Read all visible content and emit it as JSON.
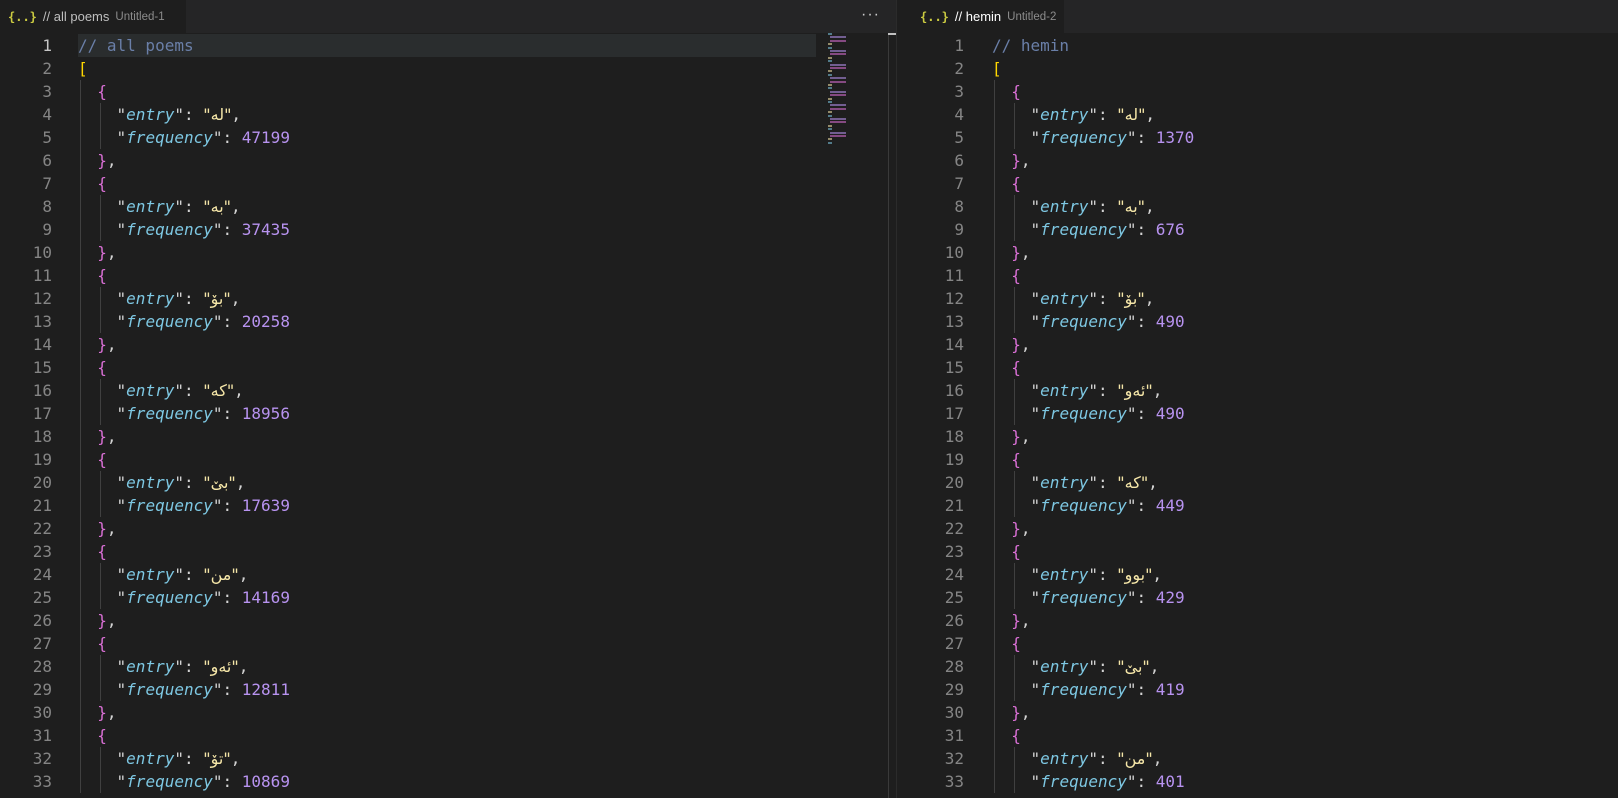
{
  "colors": {
    "background": "#1e1e1e",
    "comment": "#6a7fa8",
    "bracket": "#ffd700",
    "brace": "#da70d6",
    "key": "#7ec8e3",
    "string": "#f5e6a8",
    "number": "#b893f0"
  },
  "left": {
    "tab": {
      "icon": "{..}",
      "title": "// all poems",
      "description": "Untitled-1",
      "dirty": true
    },
    "more_actions": "···",
    "comment": "// all poems",
    "key_entry": "entry",
    "key_frequency": "frequency",
    "entries": [
      {
        "entry": "له",
        "frequency": "47199"
      },
      {
        "entry": "به",
        "frequency": "37435"
      },
      {
        "entry": "بۆ",
        "frequency": "20258"
      },
      {
        "entry": "که",
        "frequency": "18956"
      },
      {
        "entry": "بێ",
        "frequency": "17639"
      },
      {
        "entry": "من",
        "frequency": "14169"
      },
      {
        "entry": "ئەو",
        "frequency": "12811"
      },
      {
        "entry": "تۆ",
        "frequency": "10869"
      }
    ]
  },
  "right": {
    "tab": {
      "icon": "{..}",
      "title": "// hemin",
      "description": "Untitled-2",
      "dirty": true
    },
    "comment": "// hemin",
    "key_entry": "entry",
    "key_frequency": "frequency",
    "entries": [
      {
        "entry": "له",
        "frequency": "1370"
      },
      {
        "entry": "به",
        "frequency": "676"
      },
      {
        "entry": "بۆ",
        "frequency": "490"
      },
      {
        "entry": "ئەو",
        "frequency": "490"
      },
      {
        "entry": "که",
        "frequency": "449"
      },
      {
        "entry": "بوو",
        "frequency": "429"
      },
      {
        "entry": "بێ",
        "frequency": "419"
      },
      {
        "entry": "من",
        "frequency": "401"
      }
    ]
  }
}
